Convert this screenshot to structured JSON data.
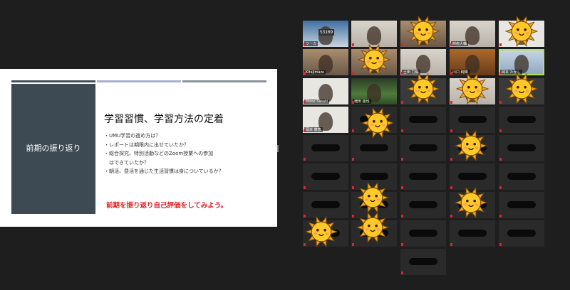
{
  "slide": {
    "side_label": "前期の振り返り",
    "title": "学習習慣、学習方法の定着",
    "bullets": [
      "・UMU学習の進め方は？",
      "・レポートは期限内に出せていたか？",
      "・総合探究、特別活動などのZoom授業への参加",
      "　はできていたか？",
      "・朝活、昼活を通じた生活習慣は身についているか？"
    ],
    "callout": "前期を振り返り自己評価をしてみよう。",
    "colors": {
      "callout": "#e02020",
      "side_panel": "#3d4a53"
    }
  },
  "gallery": {
    "tiles": [
      {
        "label": "ワーカ",
        "overlay": "S3109",
        "bg": "sky"
      },
      {
        "label": "",
        "bg": "light"
      },
      {
        "label": "",
        "bg": "room",
        "sun": true
      },
      {
        "label": "時雨大輔",
        "bg": "light"
      },
      {
        "label": "",
        "bg": "white",
        "sun": true
      },
      {
        "label": "Kitajimaze",
        "bg": "room"
      },
      {
        "label": "",
        "bg": "room",
        "sun": true
      },
      {
        "label": "土田 力毅",
        "bg": "light"
      },
      {
        "label": "川口 純輝",
        "bg": "temple"
      },
      {
        "label": "岡本 たかし",
        "bg": "blue",
        "active": true
      },
      {
        "label": "Mone Sasaki",
        "bg": "white"
      },
      {
        "label": "増田 宙也",
        "bg": "green"
      },
      {
        "label": "",
        "bg": "dark",
        "sun": true
      },
      {
        "label": "",
        "bg": "light",
        "sun": true
      },
      {
        "label": "",
        "bg": "dark",
        "sun": true
      },
      {
        "label": "岡本 康恵",
        "bg": "white"
      }
    ],
    "icons": {
      "muted_mic": "muted-mic-icon",
      "overlay": "sun-sticker-icon"
    }
  }
}
